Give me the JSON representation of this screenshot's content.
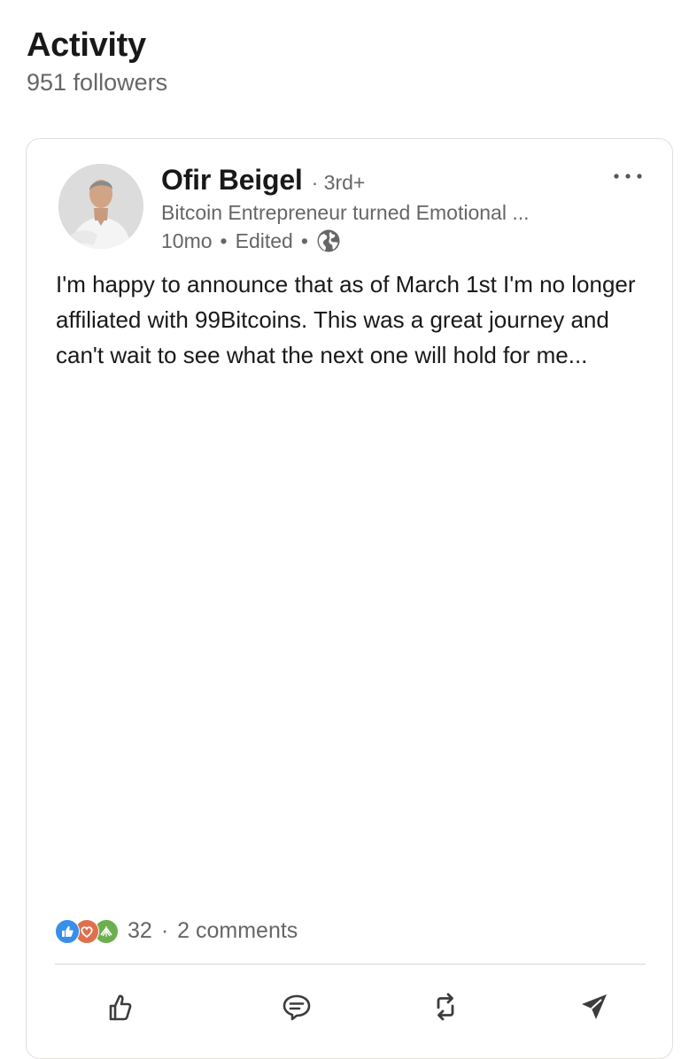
{
  "header": {
    "title": "Activity",
    "followers": "951 followers"
  },
  "post": {
    "author": {
      "name": "Ofir Beigel",
      "degree": "· 3rd+",
      "headline": "Bitcoin Entrepreneur turned Emotional ...",
      "time": "10mo",
      "edited": "Edited"
    },
    "text": "I'm happy to announce that as of March 1st I'm no longer affiliated with 99Bitcoins. This was a great journey and can't wait to see what the next one will hold for me...",
    "reactions": {
      "icons": [
        "like-icon",
        "love-icon",
        "support-icon"
      ],
      "count": "32",
      "separator": "·",
      "comments": "2 comments"
    },
    "actions": [
      "like",
      "comment",
      "repost",
      "send"
    ]
  },
  "colors": {
    "like": "#378fe9",
    "love": "#df704d",
    "support": "#6dae4f",
    "text_secondary": "#666666",
    "border": "#e0dfdc"
  }
}
